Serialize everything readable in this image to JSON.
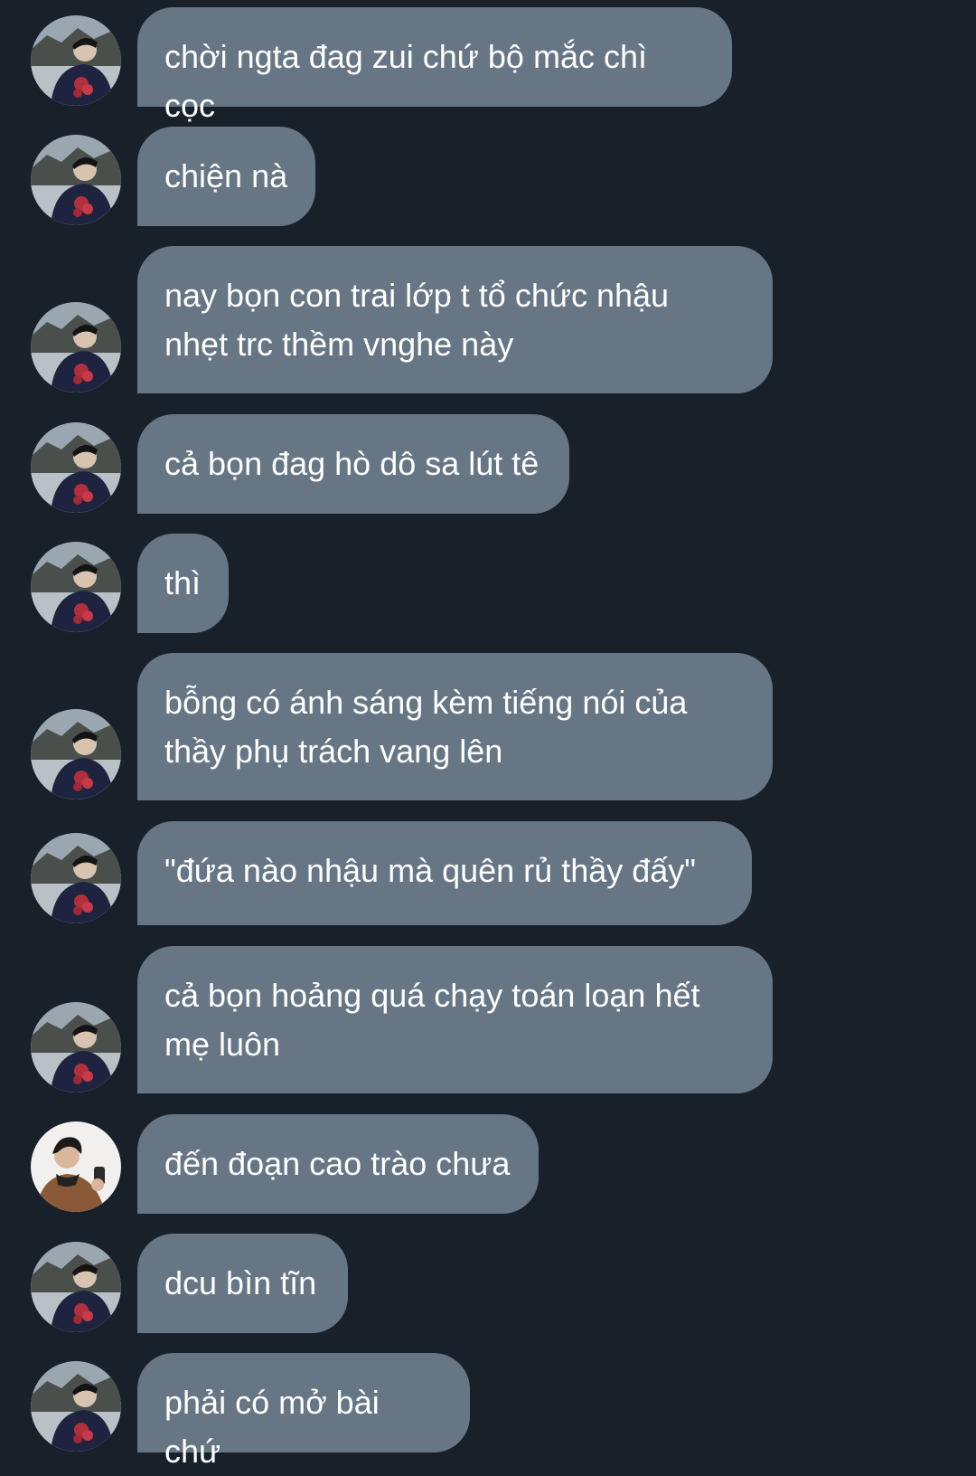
{
  "conversation": {
    "colors": {
      "background": "#18202a",
      "bubble": "#667685",
      "text": "#ffffff"
    },
    "messages": [
      {
        "sender": "friend",
        "avatar_icon": "friend-avatar-icon",
        "text": "chời ngta đag zui chứ bộ mắc chì cọc"
      },
      {
        "sender": "friend",
        "avatar_icon": "friend-avatar-icon",
        "text": "chiện nà"
      },
      {
        "sender": "friend",
        "avatar_icon": "friend-avatar-icon",
        "text": "nay bọn con trai lớp t tổ chức nhậu\nnhẹt trc thềm vnghe này"
      },
      {
        "sender": "friend",
        "avatar_icon": "friend-avatar-icon",
        "text": "cả bọn đag hò dô sa lút tê"
      },
      {
        "sender": "friend",
        "avatar_icon": "friend-avatar-icon",
        "text": "thì"
      },
      {
        "sender": "friend",
        "avatar_icon": "friend-avatar-icon",
        "text": "bỗng có ánh sáng kèm tiếng nói của\nthầy phụ trách vang lên"
      },
      {
        "sender": "friend",
        "avatar_icon": "friend-avatar-icon",
        "text": "\"đứa nào nhậu mà quên rủ thầy đấy\""
      },
      {
        "sender": "friend",
        "avatar_icon": "friend-avatar-icon",
        "text": "cả bọn hoảng quá chạy toán loạn hết\nmẹ luôn"
      },
      {
        "sender": "other",
        "avatar_icon": "other-avatar-icon",
        "text": "đến đoạn cao trào chưa"
      },
      {
        "sender": "friend",
        "avatar_icon": "friend-avatar-icon",
        "text": "dcu bìn tĩn"
      },
      {
        "sender": "friend",
        "avatar_icon": "friend-avatar-icon",
        "text": "phải có mở bài chứ"
      }
    ]
  }
}
